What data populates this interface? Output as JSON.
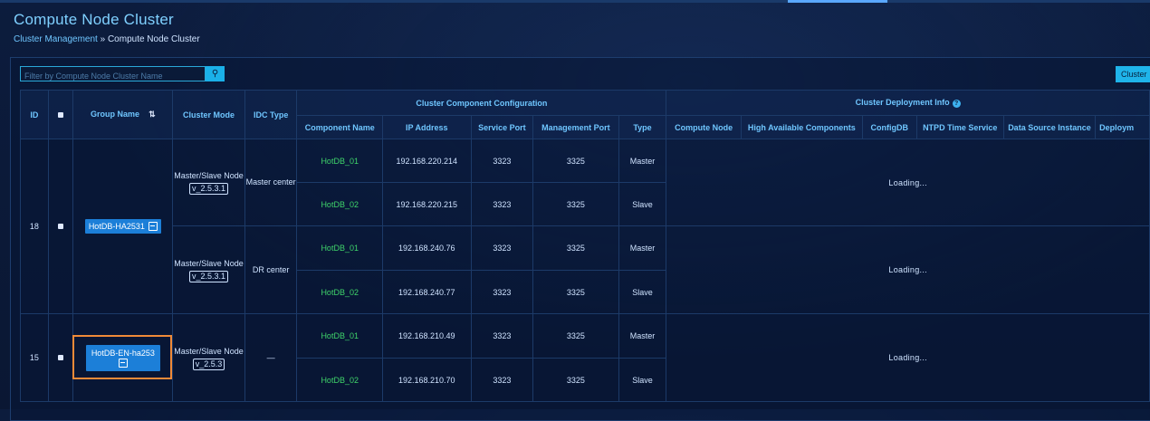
{
  "page": {
    "title": "Compute Node Cluster",
    "breadcrumb": {
      "link": "Cluster Management",
      "separator": "»",
      "current": "Compute Node Cluster"
    }
  },
  "toolbar": {
    "filter_placeholder": "Filter by Compute Node Cluster Name",
    "search_icon": "search-icon",
    "right_button_label": "Cluster"
  },
  "table": {
    "headers": {
      "id": "ID",
      "group_name": "Group Name",
      "cluster_mode": "Cluster Mode",
      "idc_type": "IDC Type",
      "component_config": "Cluster Component Configuration",
      "deployment_info": "Cluster Deployment Info",
      "component_name": "Component Name",
      "ip_address": "IP Address",
      "service_port": "Service Port",
      "management_port": "Management Port",
      "type": "Type",
      "compute_node": "Compute Node",
      "ha_components": "High Available Components",
      "configdb": "ConfigDB",
      "ntpd": "NTPD Time Service",
      "data_source": "Data Source Instance",
      "deployment": "Deploym"
    },
    "groups": [
      {
        "id": "18",
        "group_name": "HotDB-HA2531",
        "subgroups": [
          {
            "mode": "Master/Slave Node",
            "version": "v_2.5.3.1",
            "idc": "Master center",
            "status": "Loading...",
            "rows": [
              {
                "component": "HotDB_01",
                "ip": "192.168.220.214",
                "service_port": "3323",
                "management_port": "3325",
                "type": "Master"
              },
              {
                "component": "HotDB_02",
                "ip": "192.168.220.215",
                "service_port": "3323",
                "management_port": "3325",
                "type": "Slave"
              }
            ]
          },
          {
            "mode": "Master/Slave Node",
            "version": "v_2.5.3.1",
            "idc": "DR center",
            "status": "Loading...",
            "rows": [
              {
                "component": "HotDB_01",
                "ip": "192.168.240.76",
                "service_port": "3323",
                "management_port": "3325",
                "type": "Master"
              },
              {
                "component": "HotDB_02",
                "ip": "192.168.240.77",
                "service_port": "3323",
                "management_port": "3325",
                "type": "Slave"
              }
            ]
          }
        ]
      },
      {
        "id": "15",
        "group_name": "HotDB-EN-ha253",
        "subgroups": [
          {
            "mode": "Master/Slave Node",
            "version": "v_2.5.3",
            "idc": "—",
            "status": "Loading...",
            "rows": [
              {
                "component": "HotDB_01",
                "ip": "192.168.210.49",
                "service_port": "3323",
                "management_port": "3325",
                "type": "Master"
              },
              {
                "component": "HotDB_02",
                "ip": "192.168.210.70",
                "service_port": "3323",
                "management_port": "3325",
                "type": "Slave"
              }
            ]
          }
        ]
      }
    ]
  },
  "colors": {
    "accent": "#6fc6ff",
    "component_green": "#3fd46a",
    "button_blue": "#1c7fd8",
    "highlight": "#f08a38"
  }
}
